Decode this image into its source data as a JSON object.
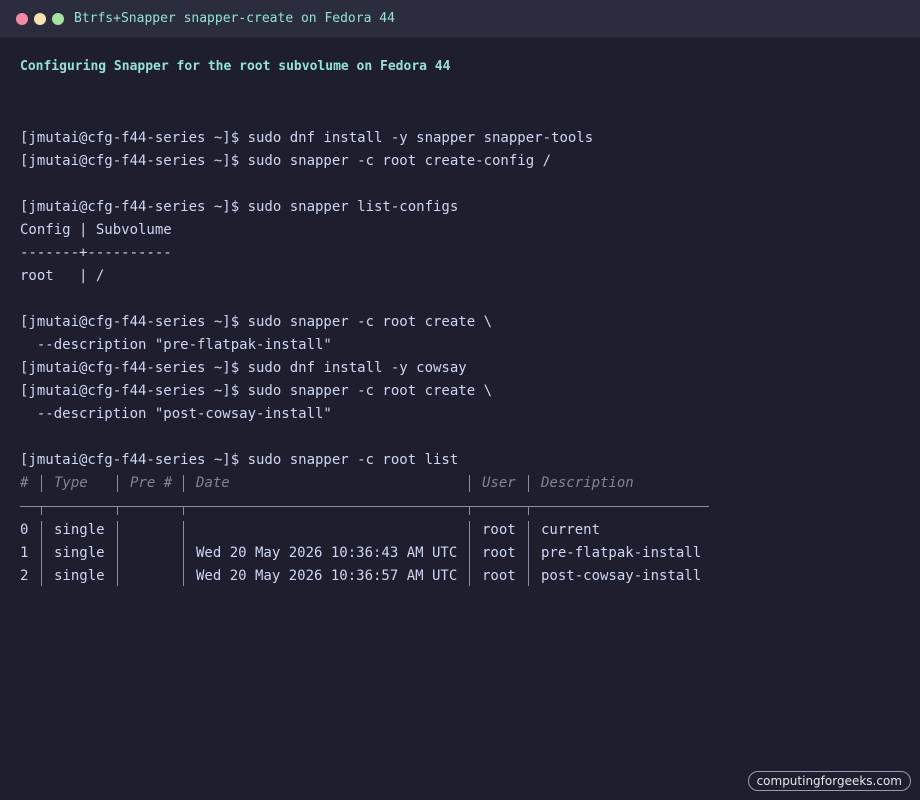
{
  "window": {
    "title": "Btrfs+Snapper snapper-create on Fedora 44"
  },
  "terminal": {
    "heading": "Configuring Snapper for the root subvolume on Fedora 44",
    "lines": [
      "[jmutai@cfg-f44-series ~]$ sudo dnf install -y snapper snapper-tools",
      "[jmutai@cfg-f44-series ~]$ sudo snapper -c root create-config /",
      "",
      "[jmutai@cfg-f44-series ~]$ sudo snapper list-configs",
      "Config | Subvolume",
      "-------+----------",
      "root   | /",
      "",
      "[jmutai@cfg-f44-series ~]$ sudo snapper -c root create \\",
      "  --description \"pre-flatpak-install\"",
      "[jmutai@cfg-f44-series ~]$ sudo dnf install -y cowsay",
      "[jmutai@cfg-f44-series ~]$ sudo snapper -c root create \\",
      "  --description \"post-cowsay-install\"",
      "",
      "[jmutai@cfg-f44-series ~]$ sudo snapper -c root list"
    ],
    "snapshot_table": {
      "headers": [
        "#",
        "Type",
        "Pre #",
        "Date",
        "User",
        "Description"
      ],
      "rows": [
        [
          "0",
          "single",
          "",
          "",
          "root",
          "current"
        ],
        [
          "1",
          "single",
          "",
          "Wed 20 May 2026 10:36:43 AM UTC",
          "root",
          "pre-flatpak-install"
        ],
        [
          "2",
          "single",
          "",
          "Wed 20 May 2026 10:36:57 AM UTC",
          "root",
          "post-cowsay-install"
        ]
      ]
    }
  },
  "watermark": "computingforgeeks.com",
  "colors": {
    "background": "#1e1e2e",
    "titlebar": "#2b2c3e",
    "accent_teal": "#94e2d5",
    "text": "#cdd6f4",
    "header_muted": "#7f849c",
    "dot_red": "#f38ba8",
    "dot_yellow": "#f9e2af",
    "dot_green": "#a6e3a1"
  }
}
